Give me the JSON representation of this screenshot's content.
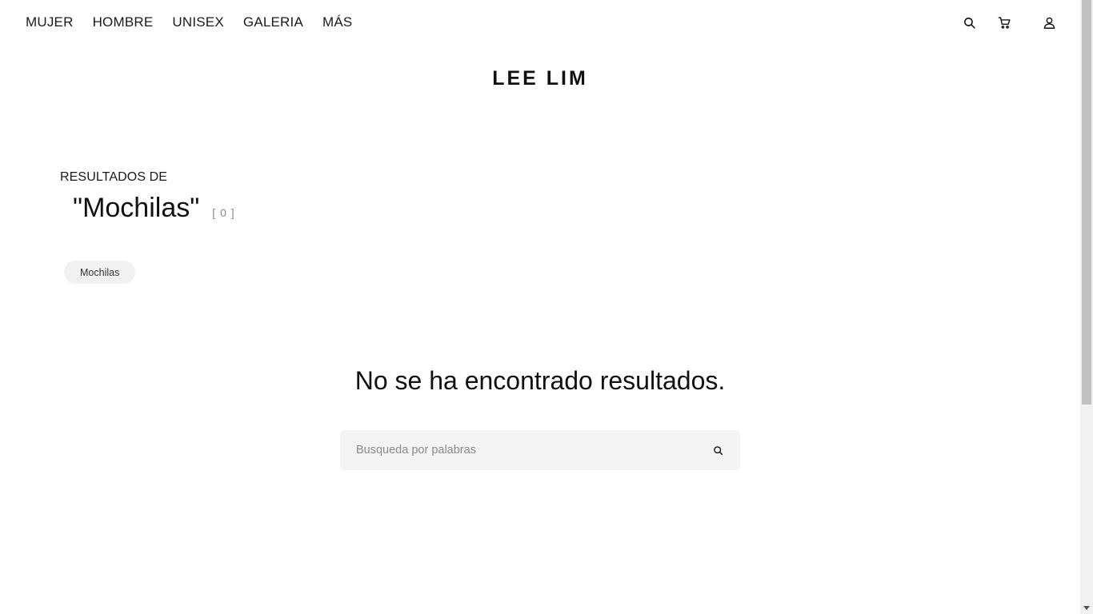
{
  "nav": {
    "items": [
      {
        "label": "MUJER"
      },
      {
        "label": "HOMBRE"
      },
      {
        "label": "UNISEX"
      },
      {
        "label": "GALERIA"
      },
      {
        "label": "MÁS"
      }
    ],
    "icons": [
      "search-icon",
      "cart-icon",
      "user-icon"
    ]
  },
  "brand": {
    "name": "LEE LIM"
  },
  "results": {
    "label": "RESULTADOS DE",
    "query": "\"Mochilas\"",
    "count": "[ 0 ]"
  },
  "tags": [
    {
      "label": "Mochilas"
    }
  ],
  "empty_state": {
    "message": "No se ha encontrado resultados.",
    "search_placeholder": "Busqueda por palabras",
    "search_value": ""
  },
  "colors": {
    "text": "#111111",
    "chip_bg": "#f1f1f1",
    "search_bg": "#f4f4f4",
    "muted": "#8a8a8a"
  }
}
